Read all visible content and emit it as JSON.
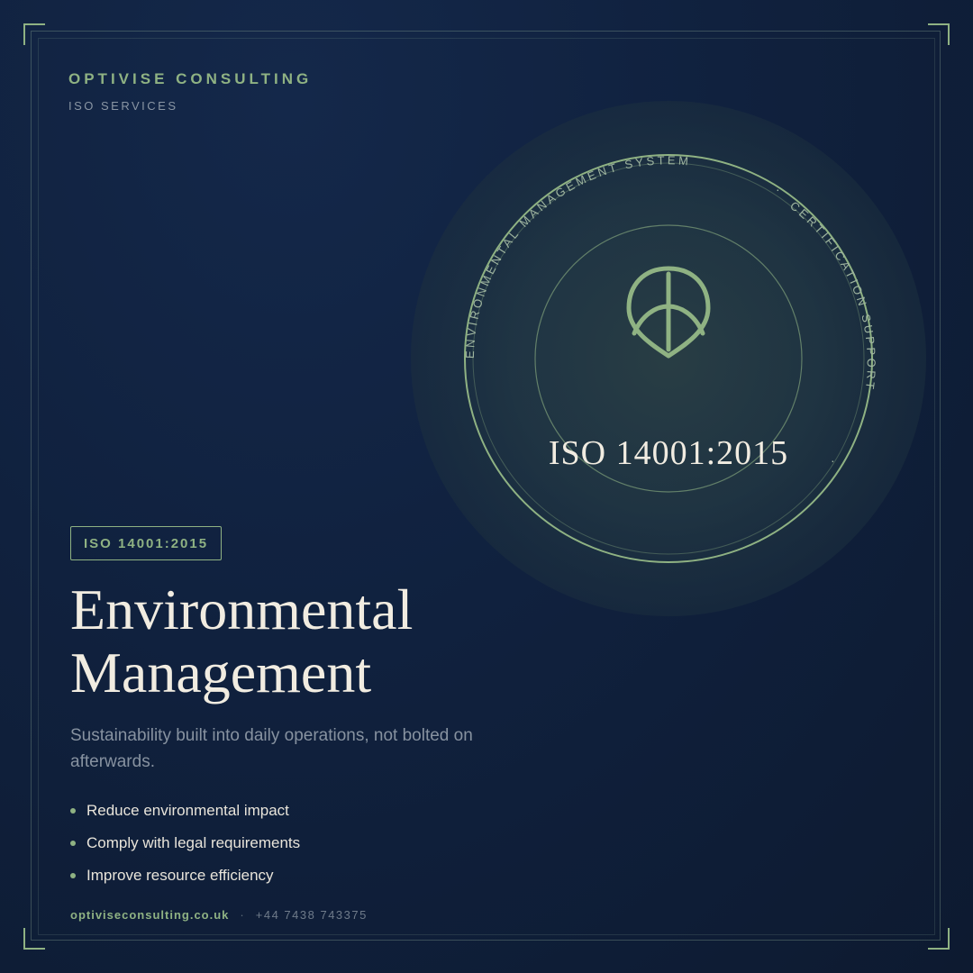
{
  "brand": {
    "name": "OPTIVISE CONSULTING",
    "subtitle": "ISO SERVICES"
  },
  "seal": {
    "ring_text_top": "ENVIRONMENTAL MANAGEMENT SYSTEM",
    "ring_separator": "·",
    "ring_text_right": "CERTIFICATION SUPPORT",
    "standard": "ISO 14001:2015",
    "icon": "leaf-icon"
  },
  "badge": {
    "label": "ISO 14001:2015"
  },
  "headline": {
    "line1": "Environmental",
    "line2": "Management"
  },
  "tagline": "Sustainability built into daily operations, not bolted on afterwards.",
  "benefits": [
    "Reduce environmental impact",
    "Comply with legal requirements",
    "Improve resource efficiency"
  ],
  "footer": {
    "website": "optiviseconsulting.co.uk",
    "separator": "·",
    "phone": "+44 7438 743375"
  },
  "colors": {
    "accent": "#8fb283",
    "background": "#10213e",
    "text": "#f1ece1",
    "muted": "#8792a0"
  }
}
